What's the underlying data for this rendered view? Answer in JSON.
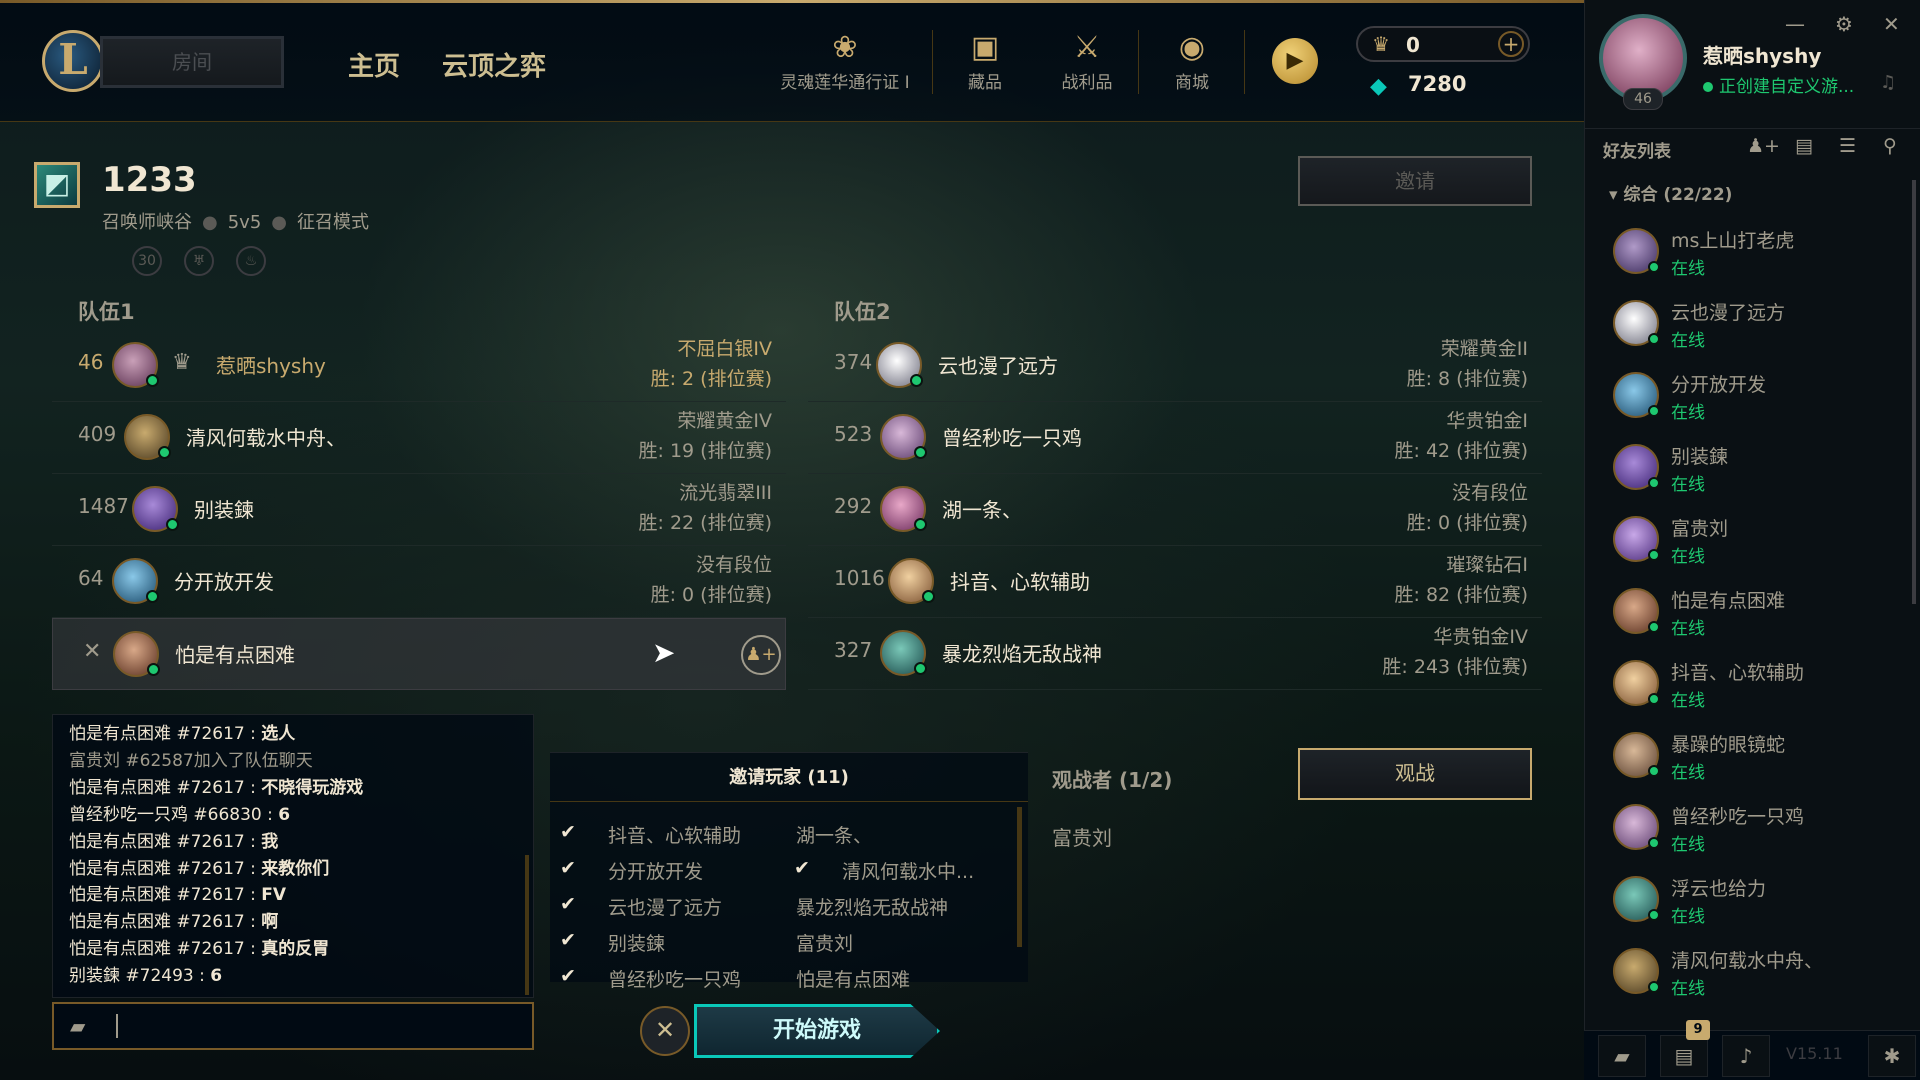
{
  "topbar": {
    "play_label": "房间",
    "nav": [
      "主页",
      "云顶之弈"
    ],
    "icons": [
      {
        "name": "soul-lotus-pass-icon",
        "label": "灵魂莲华通行证 I",
        "glyph": "❀"
      },
      {
        "name": "collection-icon",
        "label": "藏品",
        "glyph": "▣"
      },
      {
        "name": "loot-icon",
        "label": "战利品",
        "glyph": "⚔"
      },
      {
        "name": "store-icon",
        "label": "商城",
        "glyph": "◉"
      }
    ],
    "rp": "0",
    "be": "7280"
  },
  "lobby": {
    "code": "1233",
    "map": "召唤师峡谷",
    "size": "5v5",
    "mode": "征召模式",
    "invite_label": "邀请"
  },
  "team1": {
    "label": "队伍1",
    "players": [
      {
        "level": "46",
        "name": "惹晒shyshy",
        "rank": "不屈白银IV",
        "wins": "胜:  2  (排位赛)"
      },
      {
        "level": "409",
        "name": "清风何载水中舟、",
        "rank": "荣耀黄金IV",
        "wins": "胜:  19  (排位赛)"
      },
      {
        "level": "1487",
        "name": "别装鍊",
        "rank": "流光翡翠III",
        "wins": "胜:  22  (排位赛)"
      },
      {
        "level": "64",
        "name": "分开放开发",
        "rank": "没有段位",
        "wins": "胜:  0  (排位赛)"
      },
      {
        "level": "",
        "name": "怕是有点困难",
        "rank": "",
        "wins": ""
      }
    ]
  },
  "team2": {
    "label": "队伍2",
    "players": [
      {
        "level": "374",
        "name": "云也漫了远方",
        "rank": "荣耀黄金II",
        "wins": "胜:  8  (排位赛)"
      },
      {
        "level": "523",
        "name": "曾经秒吃一只鸡",
        "rank": "华贵铂金I",
        "wins": "胜:  42  (排位赛)"
      },
      {
        "level": "292",
        "name": "湖一条、",
        "rank": "没有段位",
        "wins": "胜:  0  (排位赛)"
      },
      {
        "level": "1016",
        "name": "抖音、心软辅助",
        "rank": "璀璨钻石I",
        "wins": "胜:  82  (排位赛)"
      },
      {
        "level": "327",
        "name": "暴龙烈焰无敌战神",
        "rank": "华贵铂金IV",
        "wins": "胜:  243  (排位赛)"
      }
    ]
  },
  "chat": {
    "lines": [
      {
        "sender": "怕是有点困难 #72617",
        "text": "选人",
        "sys": false
      },
      {
        "sender": "富贵刘 #62587加入了队伍聊天",
        "text": "",
        "sys": true
      },
      {
        "sender": "怕是有点困难 #72617",
        "text": "不晓得玩游戏",
        "sys": false
      },
      {
        "sender": "曾经秒吃一只鸡 #66830",
        "text": "6",
        "sys": false
      },
      {
        "sender": "怕是有点困难 #72617",
        "text": "我",
        "sys": false
      },
      {
        "sender": "怕是有点困难 #72617",
        "text": "来教你们",
        "sys": false
      },
      {
        "sender": "怕是有点困难 #72617",
        "text": "FV",
        "sys": false
      },
      {
        "sender": "怕是有点困难 #72617",
        "text": "啊",
        "sys": false
      },
      {
        "sender": "怕是有点困难 #72617",
        "text": "真的反胃",
        "sys": false
      },
      {
        "sender": "别装鍊 #72493",
        "text": "6",
        "sys": false
      }
    ]
  },
  "invite_panel": {
    "title": "邀请玩家 (11)",
    "left": [
      {
        "name": "抖音、心软辅助",
        "checked": true
      },
      {
        "name": "分开放开发",
        "checked": true
      },
      {
        "name": "云也漫了远方",
        "checked": true
      },
      {
        "name": "别装鍊",
        "checked": true
      },
      {
        "name": "曾经秒吃一只鸡",
        "checked": true
      }
    ],
    "right": [
      {
        "name": "湖一条、",
        "checked": false
      },
      {
        "name": "清风何载水中...",
        "checked": true
      },
      {
        "name": "暴龙烈焰无敌战神",
        "checked": false
      },
      {
        "name": "富贵刘",
        "checked": false
      },
      {
        "name": "怕是有点困难",
        "checked": false
      }
    ]
  },
  "start_label": "开始游戏",
  "spectators": {
    "title": "观战者 (1/2)",
    "names": [
      "富贵刘"
    ],
    "spectate_label": "观战"
  },
  "social": {
    "me": {
      "name": "惹晒shyshy",
      "level": "46",
      "status": "正创建自定义游..."
    },
    "list_title": "好友列表",
    "group": "综合 (22/22)",
    "friends": [
      {
        "name": "ms上山打老虎",
        "status": "在线"
      },
      {
        "name": "云也漫了远方",
        "status": "在线"
      },
      {
        "name": "分开放开发",
        "status": "在线"
      },
      {
        "name": "别装鍊",
        "status": "在线"
      },
      {
        "name": "富贵刘",
        "status": "在线"
      },
      {
        "name": "怕是有点困难",
        "status": "在线"
      },
      {
        "name": "抖音、心软辅助",
        "status": "在线"
      },
      {
        "name": "暴躁的眼镜蛇",
        "status": "在线"
      },
      {
        "name": "曾经秒吃一只鸡",
        "status": "在线"
      },
      {
        "name": "浮云也给力",
        "status": "在线"
      },
      {
        "name": "清风何载水中舟、",
        "status": "在线"
      }
    ],
    "badge": "9",
    "version": "V15.11"
  },
  "colors": {
    "gold": "#c8aa6e",
    "teal": "#0ac8b9",
    "online": "#1ec870"
  }
}
